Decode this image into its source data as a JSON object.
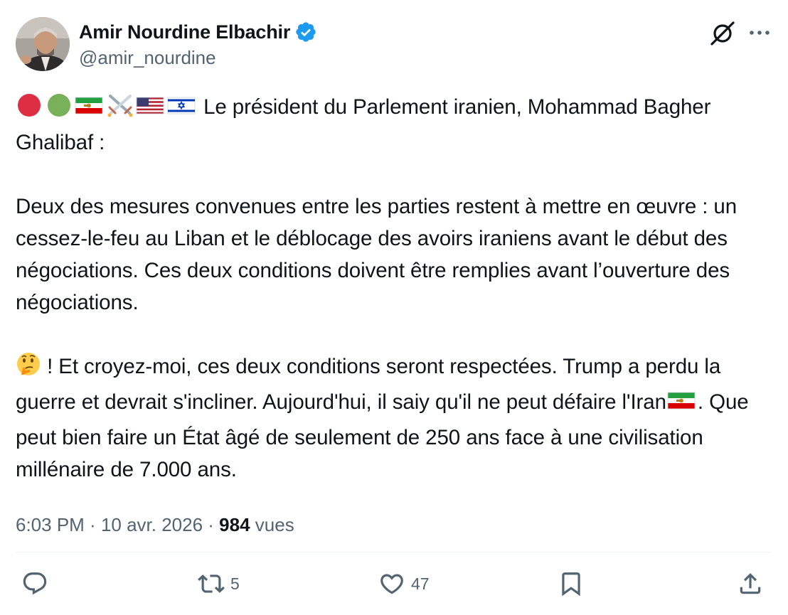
{
  "author": {
    "display_name": "Amir Nourdine Elbachir",
    "handle": "@amir_nourdine",
    "verified": true,
    "verified_color": "#1d9bf0"
  },
  "tweet": {
    "intro_emojis": [
      "red-circle",
      "green-circle",
      "iran-lion-sun-flag",
      "crossed-swords",
      "usa-flag",
      "israel-flag"
    ],
    "line1": " Le président du Parlement iranien, Mohammad Bagher Ghalibaf :",
    "paragraph2": "Deux des mesures convenues entre les parties restent à mettre en œuvre : un cessez-le-feu au Liban et le déblocage des avoirs iraniens avant le début des négociations. Ces deux conditions doivent être remplies avant l’ouverture des négociations.",
    "paragraph3_part1": " ! Et croyez-moi, ces deux conditions seront respectées. Trump a perdu la guerre et devrait s'incliner. Aujourd'hui, il saiy qu'il ne peut défaire l'Iran",
    "paragraph3_part2": ". Que peut bien faire un État âgé de seulement de 250 ans face à une civilisation millénaire de 7.000 ans."
  },
  "meta": {
    "time": "6:03 PM",
    "sep1": " · ",
    "date": "10 avr. 2026",
    "sep2": " · ",
    "views_count": "984",
    "views_label": " vues"
  },
  "actions": {
    "replies": "",
    "retweets": "5",
    "likes": "47"
  },
  "colors": {
    "text": "#0f1419",
    "secondary": "#536471",
    "divider": "#eff3f4"
  }
}
